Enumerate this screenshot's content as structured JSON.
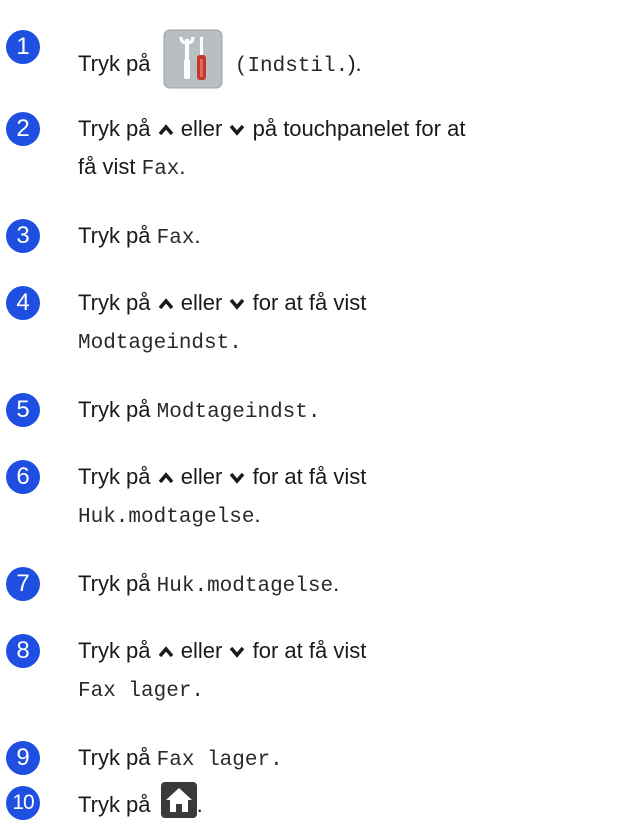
{
  "steps": [
    {
      "number": "1",
      "pre": "Tryk på",
      "icon": "settings-tools-icon",
      "code": "(Indstil.",
      "post": ")."
    },
    {
      "number": "2",
      "pre": "Tryk på",
      "up": "up-arrow-icon",
      "mid": "eller",
      "down": "down-arrow-icon",
      "post": "på touchpanelet for at",
      "line2_pre": "få vist",
      "code": "Fax",
      "line2_post": "."
    },
    {
      "number": "3",
      "pre": "Tryk på",
      "code": "Fax",
      "post": "."
    },
    {
      "number": "4",
      "pre": "Tryk på",
      "mid": "eller",
      "post": "for at få vist",
      "code": "Modtageindst",
      "line2_post": "."
    },
    {
      "number": "5",
      "pre": "Tryk på",
      "code": "Modtageindst",
      "post": "."
    },
    {
      "number": "6",
      "pre": "Tryk på",
      "mid": "eller",
      "post": "for at få vist",
      "code": "Huk.modtagelse",
      "line2_post": "."
    },
    {
      "number": "7",
      "pre": "Tryk på",
      "code": "Huk.modtagelse",
      "post": "."
    },
    {
      "number": "8",
      "pre": "Tryk på",
      "mid": "eller",
      "post": "for at få vist",
      "code": "Fax lager",
      "line2_post": "."
    },
    {
      "number": "9",
      "pre": "Tryk på",
      "code": "Fax lager",
      "post": "."
    },
    {
      "number": "10",
      "pre": "Tryk på",
      "icon": "home-icon",
      "post": "."
    }
  ],
  "colors": {
    "badge": "#1f4fe0",
    "text": "#1a1a1a",
    "icon_bg": "#b9bec2",
    "home_icon": "#3a3a3a",
    "screwdriver": "#c0392b"
  }
}
